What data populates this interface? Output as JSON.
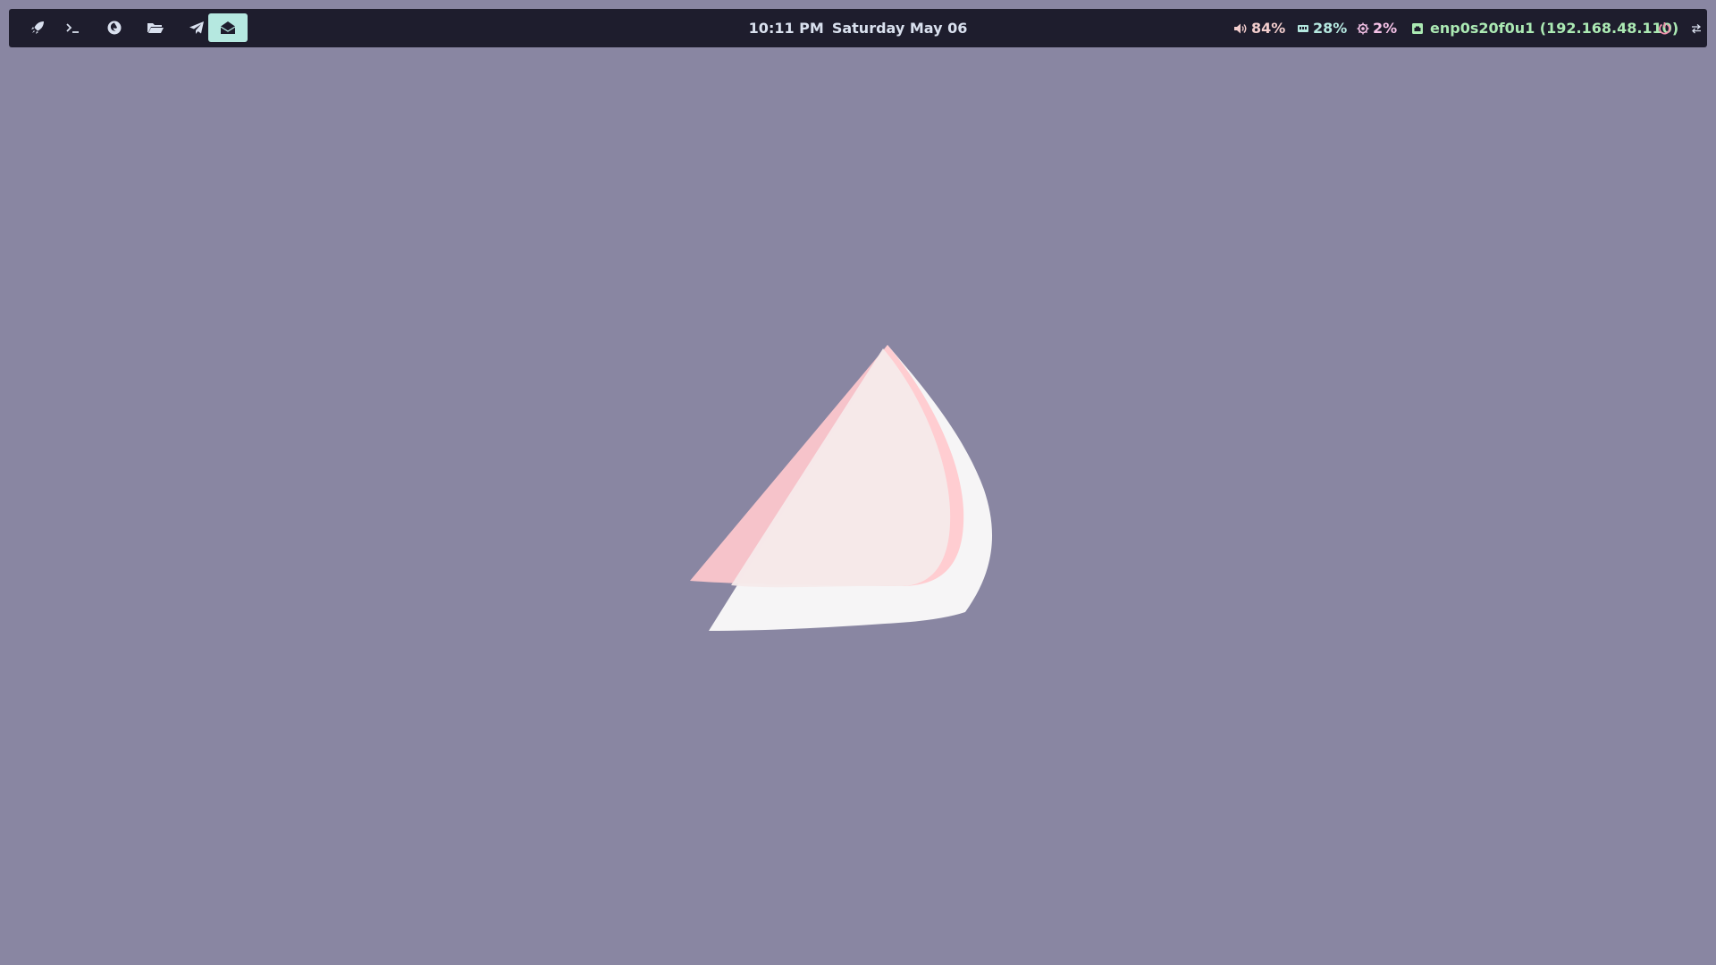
{
  "topbar": {
    "workspaces": [
      {
        "icon": "rocket-icon",
        "active": false
      },
      {
        "icon": "terminal-icon",
        "active": false
      },
      {
        "icon": "firefox-icon",
        "active": false
      },
      {
        "icon": "folder-icon",
        "active": false
      },
      {
        "icon": "paper-plane-icon",
        "active": false
      },
      {
        "icon": "envelope-open-icon",
        "active": true
      }
    ],
    "clock": {
      "time": "10:11 PM",
      "date": "Saturday May 06"
    },
    "volume": {
      "icon": "speaker-icon",
      "text": "84%",
      "color": "#f2cdcd"
    },
    "memory": {
      "icon": "memory-icon",
      "text": "28%",
      "color": "#b5e8e0"
    },
    "cpu": {
      "icon": "cpu-icon",
      "text": "2%",
      "color": "#f5c2e7"
    },
    "network": {
      "icon": "ethernet-icon",
      "text": "enp0s20f0u1 (192.168.48.110)",
      "color": "#abe9b3"
    },
    "power": {
      "icon": "power-icon",
      "color": "#f28fad"
    },
    "extra": {
      "icon": "swap-arrows-icon"
    }
  },
  "colors": {
    "bar_bg": "#1e1d2d",
    "desktop_bg": "#8986a2",
    "active_ws": "#b5e8e0"
  }
}
